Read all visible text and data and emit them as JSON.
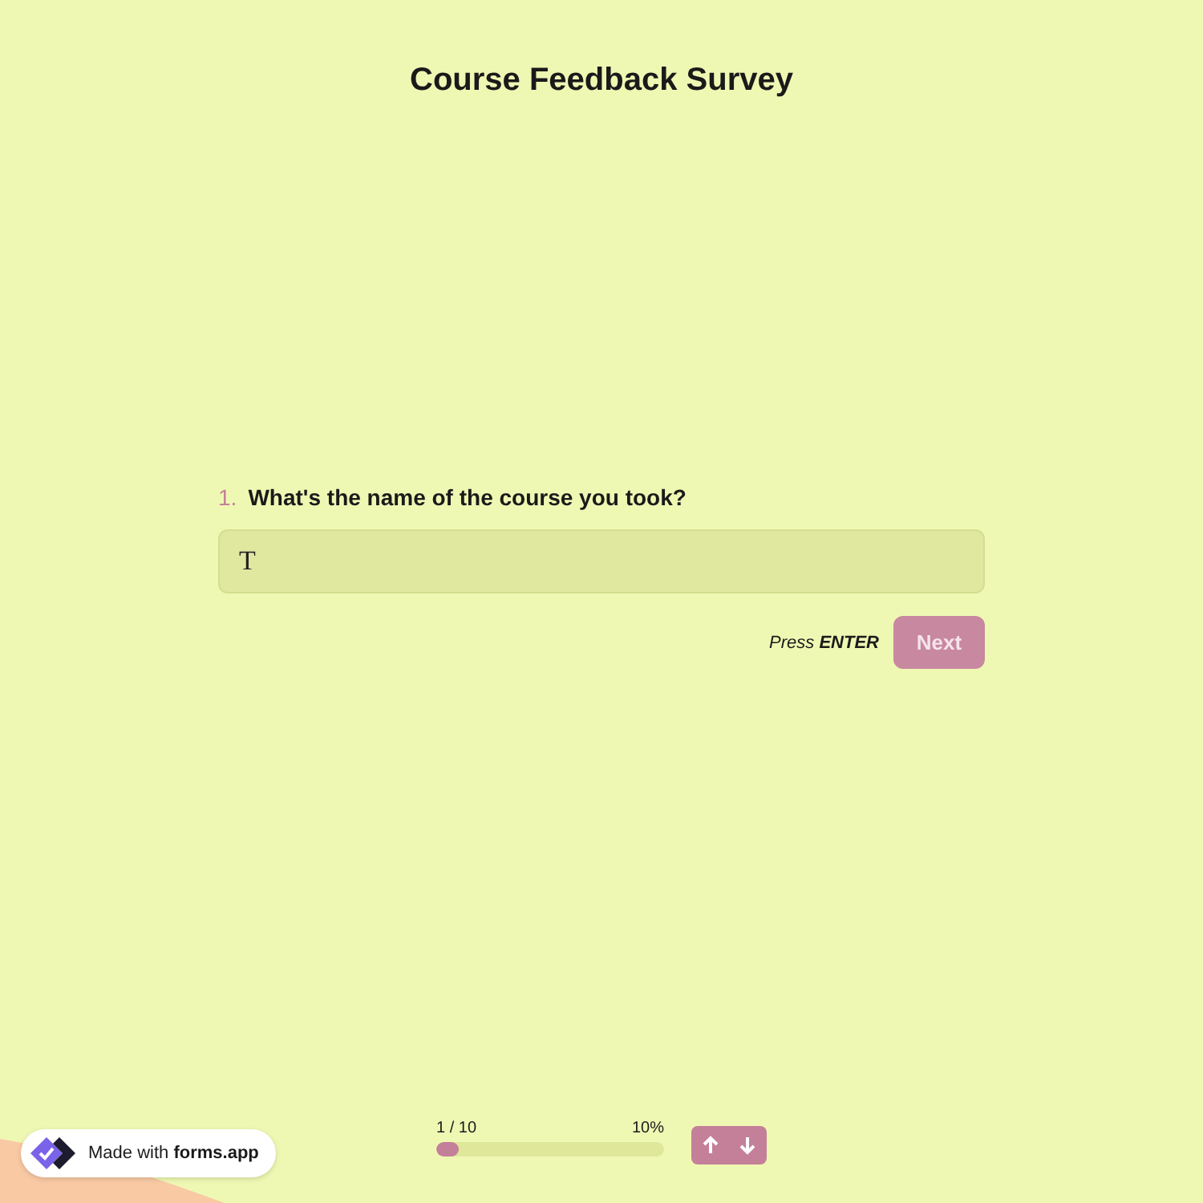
{
  "title": "Course Feedback Survey",
  "question": {
    "number": "1.",
    "text": "What's the name of the course you took?",
    "value": "T"
  },
  "hint": "Press **ENTER**",
  "next_button": {
    "label": "Next",
    "disabled": true
  },
  "progress": {
    "count": "1 / 10",
    "percent": "10%",
    "level": 0.1
  },
  "badge": {
    "text": "Made with **forms.app**"
  }
}
